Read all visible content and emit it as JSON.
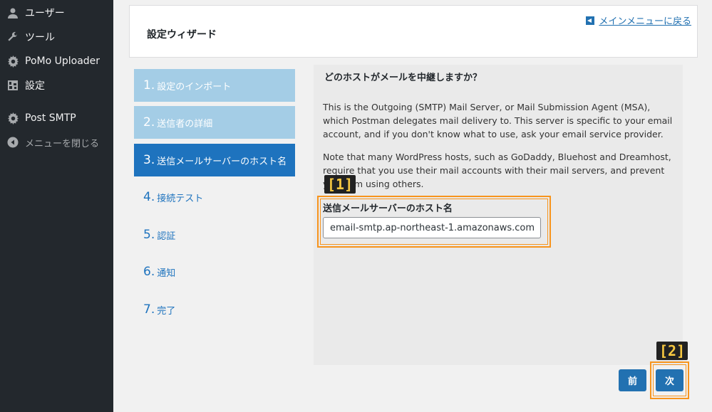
{
  "sidebar": {
    "items": [
      {
        "label": "ユーザー",
        "icon": "user-icon"
      },
      {
        "label": "ツール",
        "icon": "wrench-icon"
      },
      {
        "label": "PoMo Uploader",
        "icon": "gear-icon"
      },
      {
        "label": "設定",
        "icon": "settings-grid-icon"
      },
      {
        "label": "Post SMTP",
        "icon": "gear-icon"
      },
      {
        "label": "メニューを閉じる",
        "icon": "collapse-arrow-icon"
      }
    ]
  },
  "header": {
    "title": "設定ウィザード",
    "back_link": "メインメニューに戻る"
  },
  "steps": [
    {
      "num": "1.",
      "label": "設定のインポート",
      "state": "done"
    },
    {
      "num": "2.",
      "label": "送信者の詳細",
      "state": "done"
    },
    {
      "num": "3.",
      "label": "送信メールサーバーのホスト名",
      "state": "active"
    },
    {
      "num": "4.",
      "label": "接続テスト",
      "state": "pending"
    },
    {
      "num": "5.",
      "label": "認証",
      "state": "pending"
    },
    {
      "num": "6.",
      "label": "通知",
      "state": "pending"
    },
    {
      "num": "7.",
      "label": "完了",
      "state": "pending"
    }
  ],
  "content": {
    "question": "どのホストがメールを中継しますか？",
    "para1": "This is the Outgoing (SMTP) Mail Server, or Mail Submission Agent (MSA), which Postman delegates mail delivery to. This server is specific to your email account, and if you don't know what to use, ask your email service provider.",
    "para2": "Note that many WordPress hosts, such as GoDaddy, Bluehost and Dreamhost, require that you use their mail accounts with their mail servers, and prevent you from using others.",
    "field_label": "送信メールサーバーのホスト名",
    "field_value": "email-smtp.ap-northeast-1.amazonaws.com"
  },
  "buttons": {
    "prev": "前",
    "next": "次"
  },
  "annotations": {
    "badge1": "[1]",
    "badge2": "[2]"
  },
  "colors": {
    "accent": "#2271b1",
    "step_done": "#a4cde6",
    "step_active": "#1e73be",
    "highlight": "#f7941d",
    "sidebar_bg": "#23282d"
  }
}
